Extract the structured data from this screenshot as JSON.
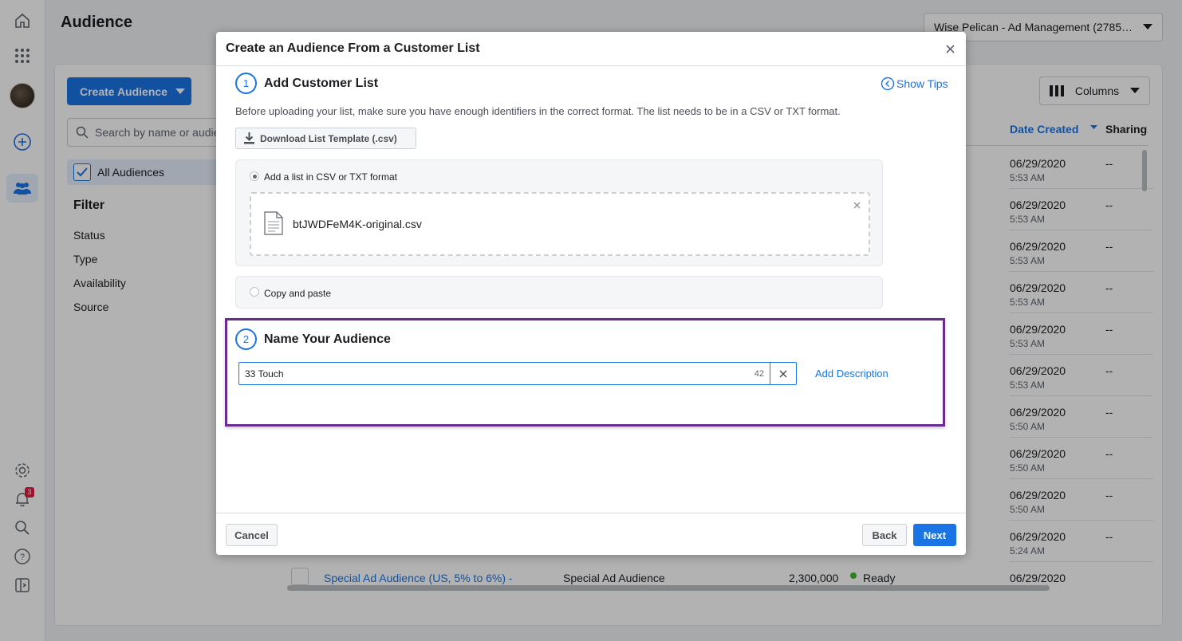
{
  "app": {
    "page_title": "Audience",
    "account_selector": "Wise Pelican - Ad Management (2785…",
    "notification_count": "3",
    "create_audience_label": "Create Audience",
    "search_placeholder": "Search by name or audie",
    "all_audiences_label": "All Audiences",
    "filter_title": "Filter",
    "filters": [
      "Status",
      "Type",
      "Availability",
      "Source"
    ],
    "columns_label": "Columns",
    "table": {
      "date_header": "Date Created",
      "sharing_header": "Sharing",
      "rows": [
        {
          "date": "06/29/2020",
          "time": "5:53 AM",
          "sharing": "--"
        },
        {
          "date": "06/29/2020",
          "time": "5:53 AM",
          "sharing": "--"
        },
        {
          "date": "06/29/2020",
          "time": "5:53 AM",
          "sharing": "--"
        },
        {
          "date": "06/29/2020",
          "time": "5:53 AM",
          "sharing": "--"
        },
        {
          "date": "06/29/2020",
          "time": "5:53 AM",
          "sharing": "--"
        },
        {
          "date": "06/29/2020",
          "time": "5:53 AM",
          "sharing": "--"
        },
        {
          "date": "06/29/2020",
          "time": "5:50 AM",
          "sharing": "--"
        },
        {
          "date": "06/29/2020",
          "time": "5:50 AM",
          "sharing": "--"
        },
        {
          "date": "06/29/2020",
          "time": "5:50 AM",
          "sharing": "--"
        },
        {
          "date": "06/29/2020",
          "time": "5:24 AM",
          "sharing": "--"
        }
      ],
      "last_row": {
        "name": "Special Ad Audience (US, 5% to 6%) -",
        "type": "Special Ad Audience",
        "size": "2,300,000",
        "availability": "Ready",
        "date": "06/29/2020"
      }
    }
  },
  "modal": {
    "title": "Create an Audience From a Customer List",
    "step1": {
      "number": "1",
      "title": "Add Customer List",
      "show_tips": "Show Tips",
      "intro": "Before uploading your list, make sure you have enough identifiers in the correct format. The list needs to be in a CSV or TXT format.",
      "download_label": "Download List Template (.csv)",
      "option_upload": "Add a list in CSV or TXT format",
      "file_name": "btJWDFeM4K-original.csv",
      "option_paste": "Copy and paste"
    },
    "step2": {
      "number": "2",
      "title": "Name Your Audience",
      "name_value": "33 Touch",
      "char_count": "42",
      "add_description": "Add Description"
    },
    "footer": {
      "cancel": "Cancel",
      "back": "Back",
      "next": "Next"
    }
  },
  "colors": {
    "accent": "#1b74e4",
    "highlight_border": "#6a2c91",
    "ready_dot": "#42b72a",
    "badge": "#e41e3f"
  }
}
